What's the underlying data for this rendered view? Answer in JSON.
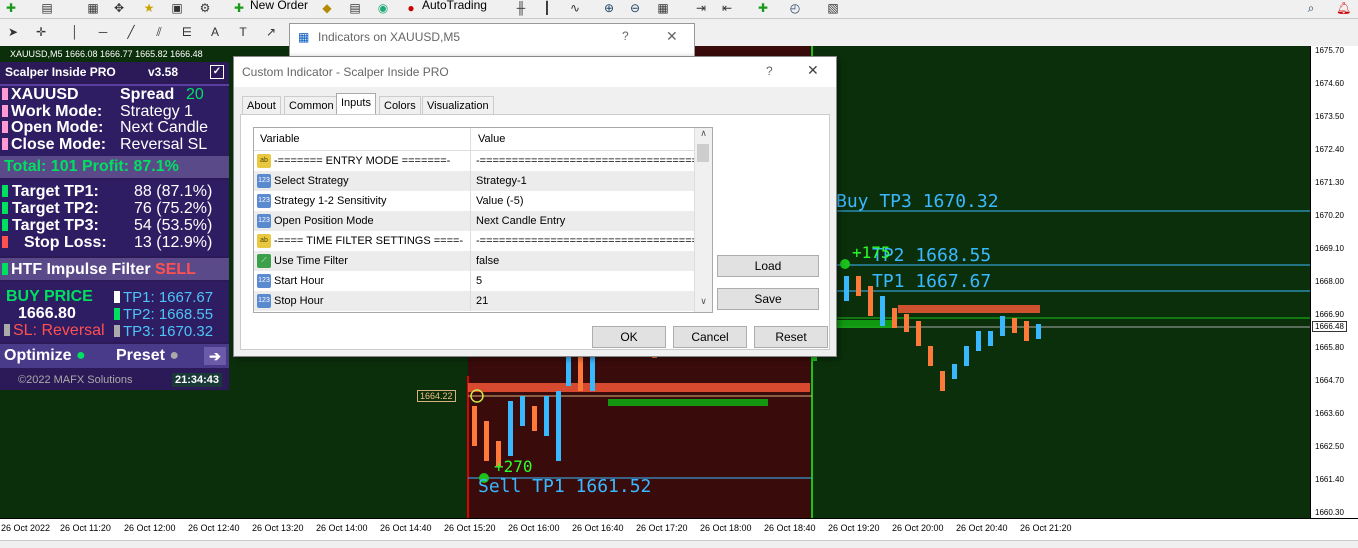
{
  "toolbar": {
    "new_order": "New Order",
    "auto_trading": "AutoTrading"
  },
  "chart_info": {
    "title": "XAUUSD,M5  1666.08 1666.77 1665.82 1666.48"
  },
  "panel": {
    "title": "Scalper Inside PRO",
    "version": "v3.58",
    "symbol": "XAUUSD",
    "spread_label": "Spread",
    "spread_value": "20",
    "work_mode_label": "Work  Mode:",
    "work_mode_value": "Strategy 1",
    "open_mode_label": "Open  Mode:",
    "open_mode_value": "Next Candle",
    "close_mode_label": "Close Mode:",
    "close_mode_value": "Reversal SL",
    "total_text": "Total: 101  Profit: 87.1%",
    "targets": [
      {
        "label": "Target TP1:",
        "value": "88 (87.1%)"
      },
      {
        "label": "Target TP2:",
        "value": "76 (75.2%)"
      },
      {
        "label": "Target TP3:",
        "value": "54 (53.5%)"
      },
      {
        "label": "Stop Loss:",
        "value": "13 (12.9%)"
      }
    ],
    "htf_label": "HTF Impulse Filter",
    "htf_value": "SELL",
    "buy_price_label": "BUY PRICE",
    "buy_price_value": "1666.80",
    "sl_text": "SL: Reversal",
    "tp1": "TP1: 1667.67",
    "tp2": "TP2: 1668.55",
    "tp3": "TP3: 1670.32",
    "optimize": "Optimize",
    "preset": "Preset",
    "copyright": "©2022 MAFX Solutions",
    "clock": "21:34:43",
    "colors": {
      "bg": "#2b1a57",
      "green": "#00e060",
      "red": "#ff5050",
      "teal": "#4fc3f7"
    }
  },
  "chart_labels": {
    "buy_tp3": "Buy  TP3 1670.32",
    "buy_tp2": "TP2 1668.55",
    "buy_tp1": "TP1 1667.67",
    "sell_tp1": "Sell TP1 1661.52",
    "plus_270": "+270",
    "plus_175": "+175",
    "price_box": "1664.22",
    "current_price": "1666.48"
  },
  "price_axis": [
    "1675.70",
    "1674.60",
    "1673.50",
    "1672.40",
    "1671.30",
    "1670.20",
    "1669.10",
    "1668.00",
    "1666.90",
    "1665.80",
    "1664.70",
    "1663.60",
    "1662.50",
    "1661.40",
    "1660.30"
  ],
  "time_axis": [
    "26 Oct 2022",
    "26 Oct 11:20",
    "26 Oct 12:00",
    "26 Oct 12:40",
    "26 Oct 13:20",
    "26 Oct 14:00",
    "26 Oct 14:40",
    "26 Oct 15:20",
    "26 Oct 16:00",
    "26 Oct 16:40",
    "26 Oct 17:20",
    "26 Oct 18:00",
    "26 Oct 18:40",
    "26 Oct 19:20",
    "26 Oct 20:00",
    "26 Oct 20:40",
    "26 Oct 21:20"
  ],
  "dialog_back": {
    "title": "Indicators on XAUUSD,M5",
    "help": "?",
    "close": "✕"
  },
  "dialog": {
    "title": "Custom Indicator - Scalper Inside PRO",
    "help": "?",
    "close": "✕",
    "tabs": [
      "About",
      "Common",
      "Inputs",
      "Colors",
      "Visualization"
    ],
    "grid_header": {
      "variable": "Variable",
      "value": "Value"
    },
    "rows": [
      {
        "icon": "ab",
        "variable": "-=======  ENTRY  MODE  =======-",
        "value": "-=====================================-"
      },
      {
        "icon": "123",
        "variable": "Select Strategy",
        "value": "Strategy-1"
      },
      {
        "icon": "123",
        "variable": "Strategy 1-2 Sensitivity",
        "value": "Value (-5)"
      },
      {
        "icon": "123",
        "variable": "Open Position Mode",
        "value": "Next Candle Entry"
      },
      {
        "icon": "ab",
        "variable": "-==== TIME FILTER SETTINGS ====-",
        "value": "-=====================================-"
      },
      {
        "icon": "bool",
        "variable": "Use Time Filter",
        "value": "false"
      },
      {
        "icon": "123",
        "variable": "Start Hour",
        "value": "5"
      },
      {
        "icon": "123",
        "variable": "Stop Hour",
        "value": "21"
      }
    ],
    "load": "Load",
    "save": "Save",
    "ok": "OK",
    "cancel": "Cancel",
    "reset": "Reset"
  }
}
